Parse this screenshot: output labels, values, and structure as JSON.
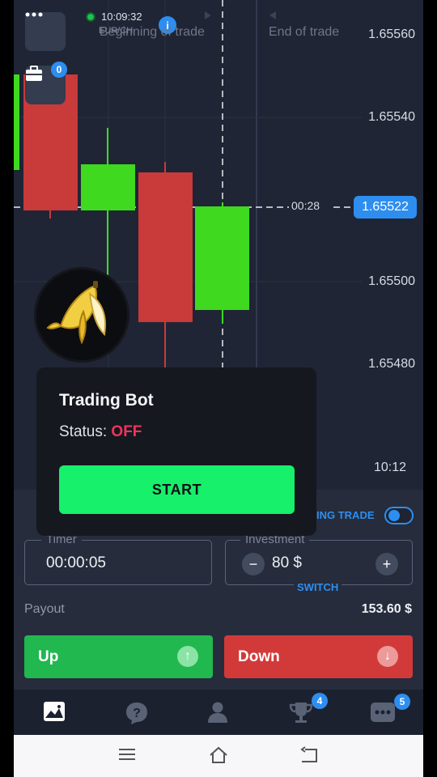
{
  "status_bar": {
    "clock": "10:09:32",
    "pair_ghost": "EUR/CH"
  },
  "chart": {
    "beginning_label": "Beginning of trade",
    "end_label": "End of trade",
    "price_ticks": [
      "1.65560",
      "1.65540",
      "1.65500",
      "1.65480"
    ],
    "current_price": "1.65522",
    "countdown": "00:28",
    "time_tick": "10:12",
    "portfolio_badge": "0",
    "colors": {
      "up": "#3fd91f",
      "down": "#c93a3a",
      "accent": "#2d8ef0"
    }
  },
  "panel": {
    "auto_trade_label": "AUTO TRADING TRADE",
    "auto_trade_visible": "ING TRADE",
    "timer_legend": "Timer",
    "timer_value": "00:00:05",
    "investment_legend": "Investment",
    "investment_value": "80 $",
    "minus_symbol": "−",
    "plus_symbol": "+",
    "switch_label": "SWITCH",
    "payout_label": "Payout",
    "payout_value": "153.60 $",
    "up_label": "Up",
    "down_label": "Down",
    "up_arrow": "↑",
    "down_arrow": "↓"
  },
  "bot": {
    "title": "Trading Bot",
    "status_label": "Status: ",
    "status_value": "OFF",
    "start_label": "START"
  },
  "nav": {
    "items": [
      "chart-icon",
      "help-icon",
      "profile-icon",
      "trophy-icon",
      "more-icon"
    ],
    "trophy_badge": "4",
    "more_badge": "5"
  },
  "sysnav": [
    "menu-icon",
    "home-icon",
    "back-icon"
  ]
}
